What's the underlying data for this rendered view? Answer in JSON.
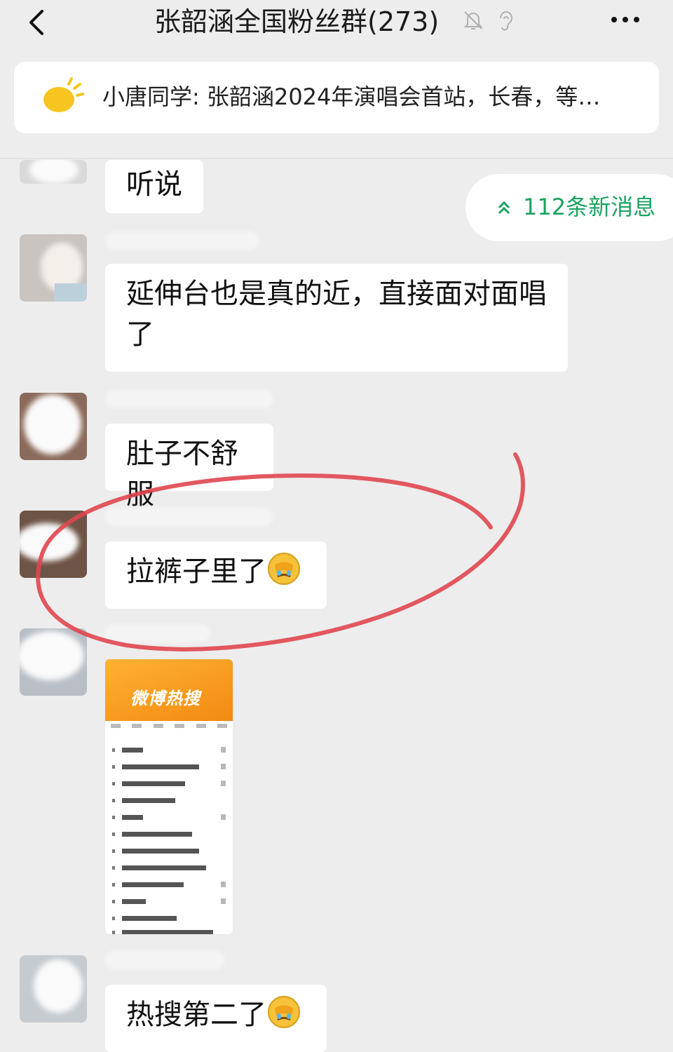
{
  "header": {
    "back_icon": "chevron-left-icon",
    "title": "张韶涵全国粉丝群(273)",
    "mute_icon": "bell-off-icon",
    "earpiece_icon": "ear-icon",
    "more_icon": "more-horizontal-icon"
  },
  "pinned": {
    "icon": "sun-icon",
    "text": "小唐同学: 张韶涵2024年演唱会首站，长春，等…"
  },
  "new_messages": {
    "icon": "double-chevron-up-icon",
    "label": "112条新消息",
    "color": "#1aa260"
  },
  "messages": [
    {
      "text": "听说"
    },
    {
      "text": "延伸台也是真的近，直接面对面唱了"
    },
    {
      "text": "肚子不舒服"
    },
    {
      "text": "拉裤子里了",
      "emoji": "facepalm-emoji"
    },
    {
      "image": {
        "title": "微博热搜",
        "type": "weibo-hot-search-screenshot"
      }
    },
    {
      "text": "热搜第二了",
      "emoji": "facepalm-emoji"
    }
  ],
  "annotation": {
    "type": "hand-drawn-circle",
    "color": "#e0464f"
  }
}
